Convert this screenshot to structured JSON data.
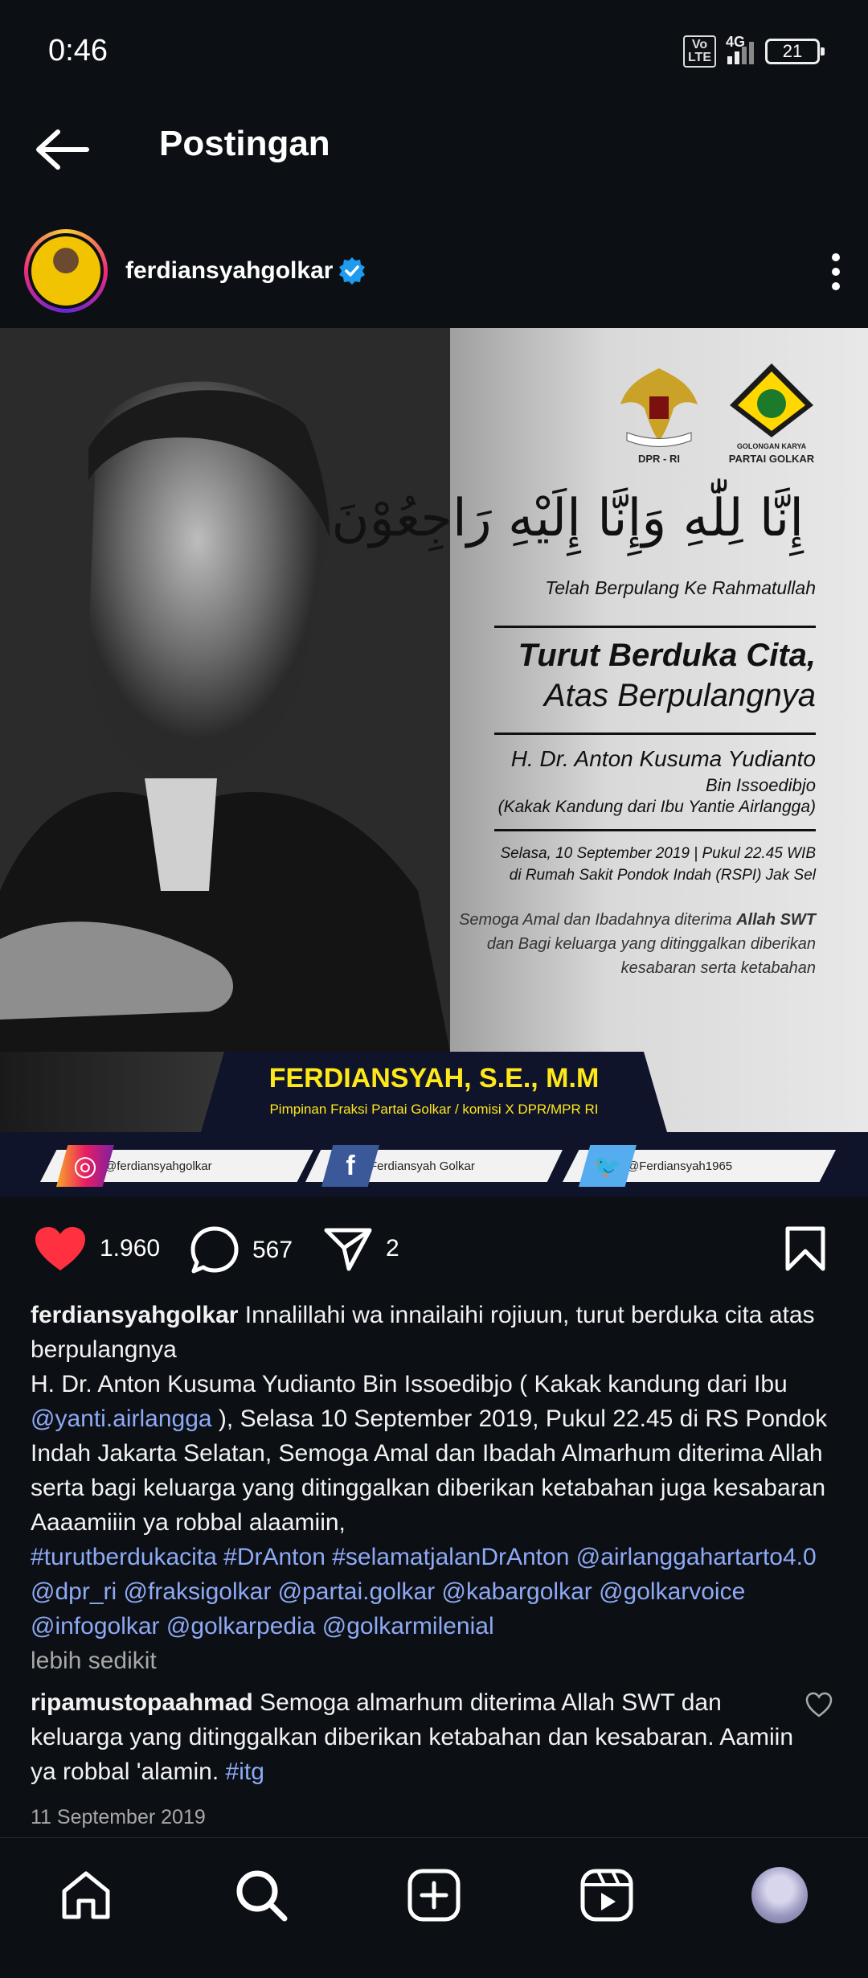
{
  "status_bar": {
    "time": "0:46",
    "volte": "Vo\nLTE",
    "network": "4G",
    "battery": "21"
  },
  "header": {
    "title": "Postingan"
  },
  "post": {
    "username": "ferdiansyahgolkar",
    "image": {
      "emblem_dpr": "DPR - RI",
      "emblem_golkar_top": "GOLONGAN KARYA",
      "emblem_golkar": "PARTAI GOLKAR",
      "arabic": "إِنَّا لِلّٰهِ وَإِنَّا إِلَيْهِ رَاجِعُوْنَ",
      "line1": "Telah Berpulang Ke Rahmatullah",
      "heading1": "Turut Berduka Cita,",
      "heading2": "Atas Berpulangnya",
      "deceased": "H. Dr. Anton Kusuma Yudianto",
      "deceased_2": "Bin Issoedibjo",
      "relation": "(Kakak Kandung dari Ibu Yantie Airlangga)",
      "date_line": "Selasa, 10 September 2019 | Pukul 22.45 WIB",
      "place_line": "di Rumah Sakit Pondok Indah (RSPI) Jak Sel",
      "prayer1_a": "Semoga Amal dan Ibadahnya diterima ",
      "prayer1_b": "Allah SWT",
      "prayer2": "dan Bagi keluarga yang ditinggalkan diberikan",
      "prayer3": "kesabaran serta ketabahan",
      "banner_name": "FERDIANSYAH, S.E., M.M",
      "banner_role": "Pimpinan Fraksi Partai Golkar / komisi X DPR/MPR RI",
      "social_instagram": "@ferdiansyahgolkar",
      "social_facebook": "Ferdiansyah Golkar",
      "social_twitter": "@Ferdiansyah1965"
    },
    "likes": "1.960",
    "comments": "567",
    "shares": "2",
    "caption": {
      "username": "ferdiansyahgolkar",
      "text1": " Innalillahi wa innailaihi rojiuun, turut berduka cita atas berpulangnya",
      "text2": "H. Dr. Anton Kusuma Yudianto Bin Issoedibjo ( Kakak kandung dari Ibu ",
      "mention1": "@yanti.airlangga",
      "text3": " ), Selasa 10 September 2019, Pukul 22.45 di RS Pondok Indah Jakarta Selatan, Semoga Amal dan Ibadah Almarhum diterima Allah serta bagi keluarga yang ditinggalkan diberikan ketabahan juga kesabaran Aaaamiiin ya robbal alaamiin,",
      "tags": "#turutberdukacita #DrAnton #selamatjalanDrAnton @airlanggahartarto4.0 @dpr_ri @fraksigolkar @partai.golkar @kabargolkar @golkarvoice @infogolkar @golkarpedia @golkarmilenial",
      "less": "lebih sedikit"
    },
    "comment": {
      "username": "ripamustopaahmad",
      "text": " Semoga almarhum diterima Allah SWT dan keluarga yang ditinggalkan diberikan ketabahan dan kesabaran. Aamiin ya robbal 'alamin. ",
      "tag": "#itg"
    },
    "date": "11 September 2019"
  },
  "colors": {
    "background": "#0c1014",
    "like": "#ff3040",
    "link": "#8ea9f5",
    "verified": "#1d9bf0"
  }
}
